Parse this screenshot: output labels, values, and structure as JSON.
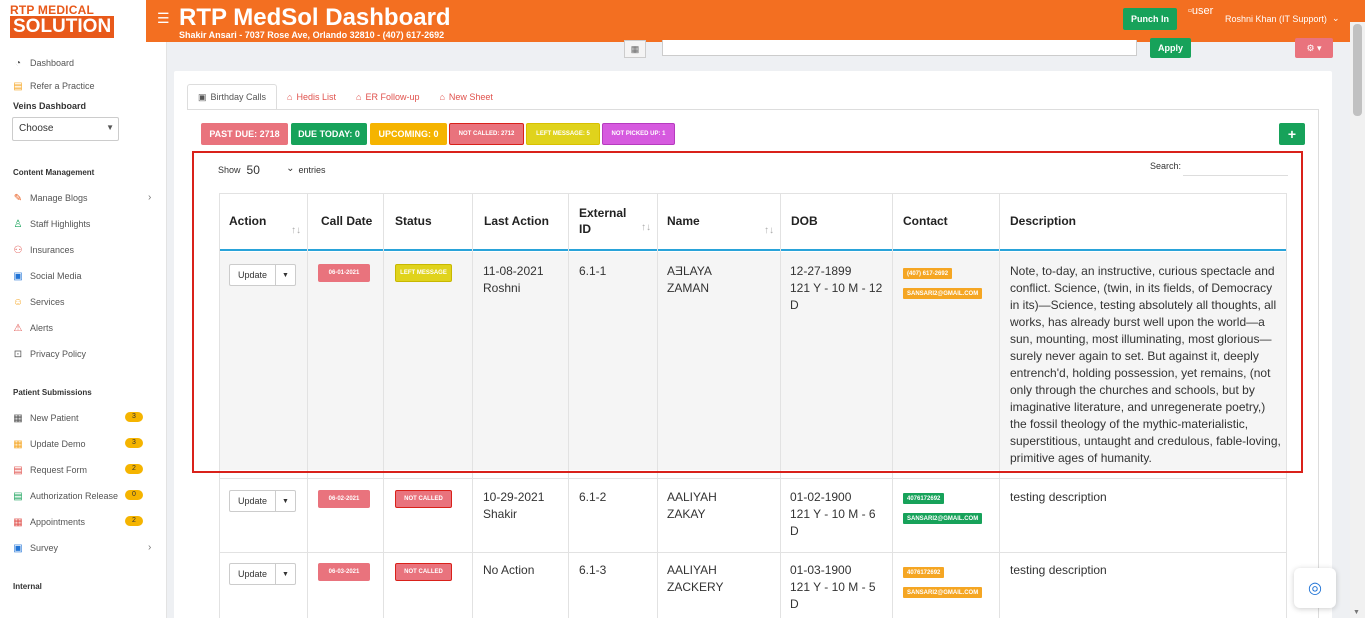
{
  "header": {
    "logo_line1": "RTP MEDICAL",
    "logo_line2": "SOLUTION",
    "title": "RTP MedSol Dashboard",
    "subtitle": "Shakir Ansari - 7037 Rose Ave, Orlando 32810 - (407) 617-2692",
    "punch_label": "Punch In",
    "user_img_alt": "user",
    "user_name": "Roshni Khan (IT Support)"
  },
  "sidebar": {
    "items_top": [
      {
        "label": "Dashboard",
        "icon": "dashboard-icon"
      },
      {
        "label": "Refer a Practice",
        "icon": "refer-icon"
      }
    ],
    "veins_label": "Veins Dashboard",
    "choose_value": "Choose",
    "content_head": "Content Management",
    "content_items": [
      {
        "label": "Manage Blogs",
        "icon": "blog-icon",
        "chev": "›"
      },
      {
        "label": "Staff Highlights",
        "icon": "staff-icon"
      },
      {
        "label": "Insurances",
        "icon": "insurance-icon"
      },
      {
        "label": "Social Media",
        "icon": "social-icon"
      },
      {
        "label": "Services",
        "icon": "services-icon"
      },
      {
        "label": "Alerts",
        "icon": "alerts-icon"
      },
      {
        "label": "Privacy Policy",
        "icon": "privacy-icon"
      }
    ],
    "patient_head": "Patient Submissions",
    "patient_items": [
      {
        "label": "New Patient",
        "icon": "new-patient-icon",
        "badge": "3"
      },
      {
        "label": "Update Demo",
        "icon": "update-demo-icon",
        "badge": "3"
      },
      {
        "label": "Request Form",
        "icon": "request-icon",
        "badge": "2"
      },
      {
        "label": "Authorization Release",
        "icon": "auth-icon",
        "badge": "0"
      },
      {
        "label": "Appointments",
        "icon": "appointments-icon",
        "badge": "2"
      },
      {
        "label": "Survey",
        "icon": "survey-icon",
        "chev": "›"
      }
    ],
    "internal_head": "Internal"
  },
  "toolbar": {
    "apply_label": "Apply"
  },
  "tabs": [
    {
      "label": "Birthday Calls",
      "active": true
    },
    {
      "label": "Hedis List"
    },
    {
      "label": "ER Follow-up"
    },
    {
      "label": "New Sheet"
    }
  ],
  "pills": [
    {
      "label": "PAST DUE: 2718",
      "color": "#e9737d"
    },
    {
      "label": "DUE TODAY: 0",
      "color": "#17a25a"
    },
    {
      "label": "UPCOMING: 0",
      "color": "#f5b400"
    },
    {
      "label": "NOT CALLED: 2712",
      "color": "#e9737d"
    },
    {
      "label": "LEFT MESSAGE: 5",
      "color": "#e0d31c"
    },
    {
      "label": "NOT PICKED UP: 1",
      "color": "#d65adf"
    }
  ],
  "table_controls": {
    "show_label": "Show",
    "entries_value": "50",
    "entries_label": "entries",
    "search_label": "Search:"
  },
  "table": {
    "columns": [
      "Action",
      "Call Date",
      "Status",
      "Last Action",
      "External ID",
      "Name",
      "DOB",
      "Contact",
      "Description"
    ],
    "update_label": "Update",
    "rows": [
      {
        "call_date": "06-01-2021",
        "status": "LEFT MESSAGE",
        "status_color": "#e0d31c",
        "last_action_date": "11-08-2021",
        "last_action_by": "Roshni",
        "external_id": "6.1-1",
        "first_name": "AƎLAYA",
        "last_name": "ZAMAN",
        "dob": "12-27-1899",
        "age_line1": "121 Y - 10 M - 12",
        "age_line2": "D",
        "phone": "(407) 617-2692",
        "email": "SANSARI2@GMAIL.COM",
        "contact_color": "#f5a623",
        "description_lines": [
          "Note, to-day, an instructive, curious spectacle and",
          "conflict. Science, (twin, in its fields, of Democracy",
          "in its)—Science, testing absolutely all thoughts, all",
          "works, has already burst well upon the world—a",
          "sun, mounting, most illuminating, most glorious—",
          "surely never again to set. But against it, deeply",
          "entrench'd, holding possession, yet remains, (not",
          "only through the churches and schools, but by",
          "imaginative literature, and unregenerate poetry,)",
          "the fossil theology of the mythic-materialistic,",
          "superstitious, untaught and credulous, fable-loving,",
          "primitive ages of humanity."
        ]
      },
      {
        "call_date": "06-02-2021",
        "status": "NOT CALLED",
        "status_color": "#e9737d",
        "last_action_date": "10-29-2021",
        "last_action_by": "Shakir",
        "external_id": "6.1-2",
        "first_name": "AALIYAH",
        "last_name": "ZAKAY",
        "dob": "01-02-1900",
        "age_line1": "121 Y - 10 M - 6",
        "age_line2": "D",
        "phone": "4076172692",
        "email": "SANSARI2@GMAIL.COM",
        "contact_color": "#17a25a",
        "description_lines": [
          "testing description"
        ]
      },
      {
        "call_date": "06-03-2021",
        "status": "NOT CALLED",
        "status_color": "#e9737d",
        "last_action_date": "No Action",
        "last_action_by": "",
        "external_id": "6.1-3",
        "first_name": "AALIYAH",
        "last_name": "ZACKERY",
        "dob": "01-03-1900",
        "age_line1": "121 Y - 10 M - 5",
        "age_line2": "D",
        "phone": "4076172692",
        "email": "SANSARI2@GMAIL.COM",
        "contact_color": "#f5a623",
        "description_lines": [
          "testing description"
        ]
      }
    ]
  }
}
